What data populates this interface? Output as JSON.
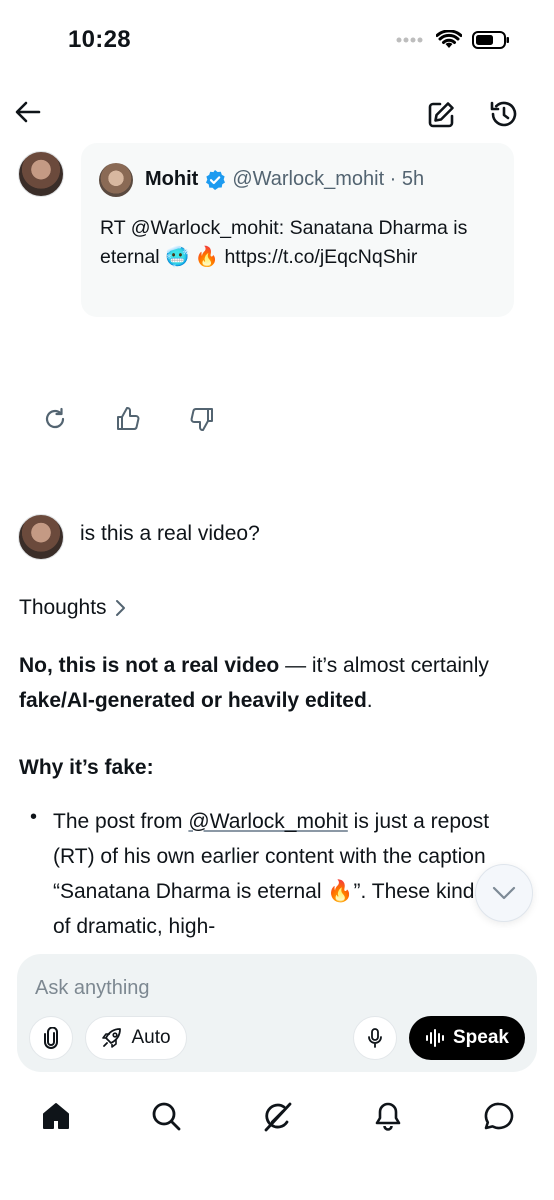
{
  "status_bar": {
    "time": "10:28"
  },
  "header": {
    "back_icon": "arrow-left-icon",
    "new_chat_icon": "compose-icon",
    "history_icon": "history-icon"
  },
  "tweet": {
    "name": "Mohit",
    "verified": true,
    "handle_time": "@Warlock_mohit · 5h",
    "text_line1": "RT @Warlock_mohit: Sanatana Dharma is",
    "text_line2_prefix": "eternal",
    "emoji": "🥶 🔥",
    "url": "https://t.co/jEqcNqShir"
  },
  "actions": [
    "refresh-icon",
    "thumbs-up-icon",
    "thumbs-down-icon"
  ],
  "user_message": "is this a real video?",
  "thoughts_label": "Thoughts",
  "answer": {
    "p1_bold": "No, this is not a real video",
    "p1_mid": " — it’s almost certainly ",
    "p1_bold2": "fake/AI-generated or heavily edited",
    "p1_end": ".",
    "heading": "Why it’s fake:",
    "bullet_pre": "The post from ",
    "bullet_link": "@Warlock_mohit",
    "bullet_post": " is just a repost (RT) of his own earlier content with the caption “Sanatana Dharma is eternal 🔥”. These kinds of dramatic, high-"
  },
  "composer": {
    "placeholder": "Ask anything",
    "auto_label": "Auto",
    "speak_label": "Speak"
  },
  "colors": {
    "accent": "#1d9bf0",
    "text": "#0f1419",
    "muted": "#536471"
  },
  "bottom_nav": [
    "home-icon",
    "search-icon",
    "grok-icon",
    "notifications-icon",
    "messages-icon"
  ]
}
